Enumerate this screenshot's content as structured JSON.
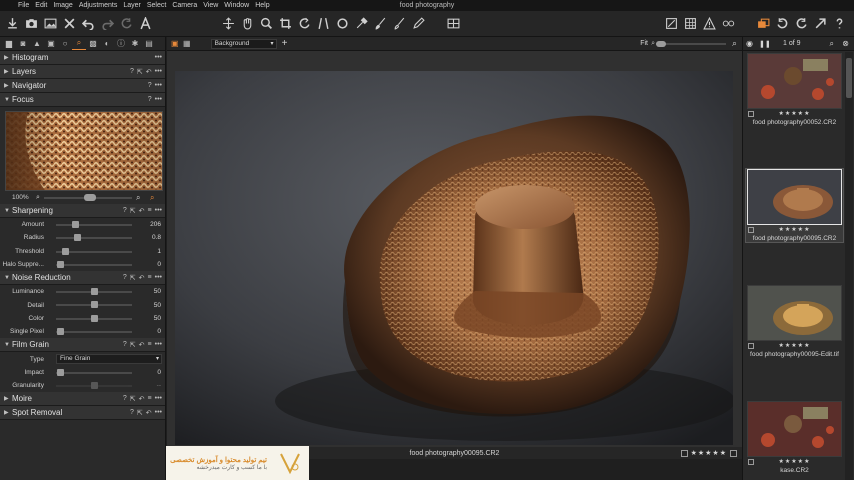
{
  "window": {
    "title": "food photography"
  },
  "menu": [
    "File",
    "Edit",
    "Image",
    "Adjustments",
    "Layer",
    "Select",
    "Camera",
    "View",
    "Window",
    "Help"
  ],
  "toolbar": {
    "left_icons": [
      "import-icon",
      "camera-icon",
      "image-icon",
      "delete-icon",
      "undo-icon",
      "redo-icon",
      "reset-icon",
      "text-tool-icon"
    ],
    "tools": [
      "pan-icon",
      "hand-icon",
      "loupe-icon",
      "crop-icon",
      "rotate-icon",
      "keystone-icon",
      "circle-mask-icon",
      "eyedropper-icon",
      "brush-icon",
      "erase-icon",
      "pen-icon"
    ],
    "right_icons": [
      "grid-view-icon",
      "layers-icon",
      "calculator-icon",
      "warning-icon",
      "glasses-icon",
      "copy-icon",
      "rotate-left-icon",
      "rotate-right-icon",
      "share-icon",
      "help-icon"
    ]
  },
  "tool_tabs": [
    "library-tab",
    "capture-tab",
    "exposure-tab",
    "color-tab",
    "lens-tab",
    "details-tab",
    "local-tab",
    "adjust-tab",
    "metadata-tab",
    "output-tab",
    "batch-tab"
  ],
  "left": {
    "sections": {
      "histogram": "Histogram",
      "layers": "Layers",
      "navigator": "Navigator",
      "focus": "Focus",
      "sharpening": "Sharpening",
      "noise": "Noise Reduction",
      "grain": "Film Grain",
      "moire": "Moire",
      "spot": "Spot Removal"
    },
    "focus_zoom": "100%",
    "sharpening": [
      {
        "label": "Amount",
        "value": "206",
        "pos": 0.25
      },
      {
        "label": "Radius",
        "value": "0.8",
        "pos": 0.28
      },
      {
        "label": "Threshold",
        "value": "1",
        "pos": 0.12
      },
      {
        "label": "Halo Suppre...",
        "value": "0",
        "pos": 0.05
      }
    ],
    "noise": [
      {
        "label": "Luminance",
        "value": "50",
        "pos": 0.5
      },
      {
        "label": "Detail",
        "value": "50",
        "pos": 0.5
      },
      {
        "label": "Color",
        "value": "50",
        "pos": 0.5
      },
      {
        "label": "Single Pixel",
        "value": "0",
        "pos": 0.05
      }
    ],
    "grain": {
      "type_label": "Type",
      "type_value": "Fine Grain",
      "impact_label": "Impact",
      "impact_value": "0",
      "impact_pos": 0.05,
      "granularity_label": "Granularity",
      "granularity_value": "--",
      "granularity_pos": 0.5
    }
  },
  "viewer": {
    "background_dropdown": "Background",
    "fit_label": "Fit",
    "filename": "food photography00095.CR2",
    "rating": "★★★★★"
  },
  "browser": {
    "count": "1 of 9",
    "thumbnails": [
      {
        "name": "food photography00052.CR2",
        "rating": "★★★★★",
        "selected": false
      },
      {
        "name": "food photography00095.CR2",
        "rating": "★★★★★",
        "selected": true
      },
      {
        "name": "food photography00095-Edit.tif",
        "rating": "★★★★★",
        "selected": false
      },
      {
        "name": "kase.CR2",
        "rating": "★★★★★",
        "selected": false
      }
    ]
  },
  "watermark": {
    "line1": "تیم تولید محتوا و آموزش تخصصی",
    "line2": "با ما کسب و کارت میدرخشه"
  },
  "colors": {
    "accent": "#e8893a",
    "panel": "#2a2a2a",
    "viewer": "#303030"
  }
}
